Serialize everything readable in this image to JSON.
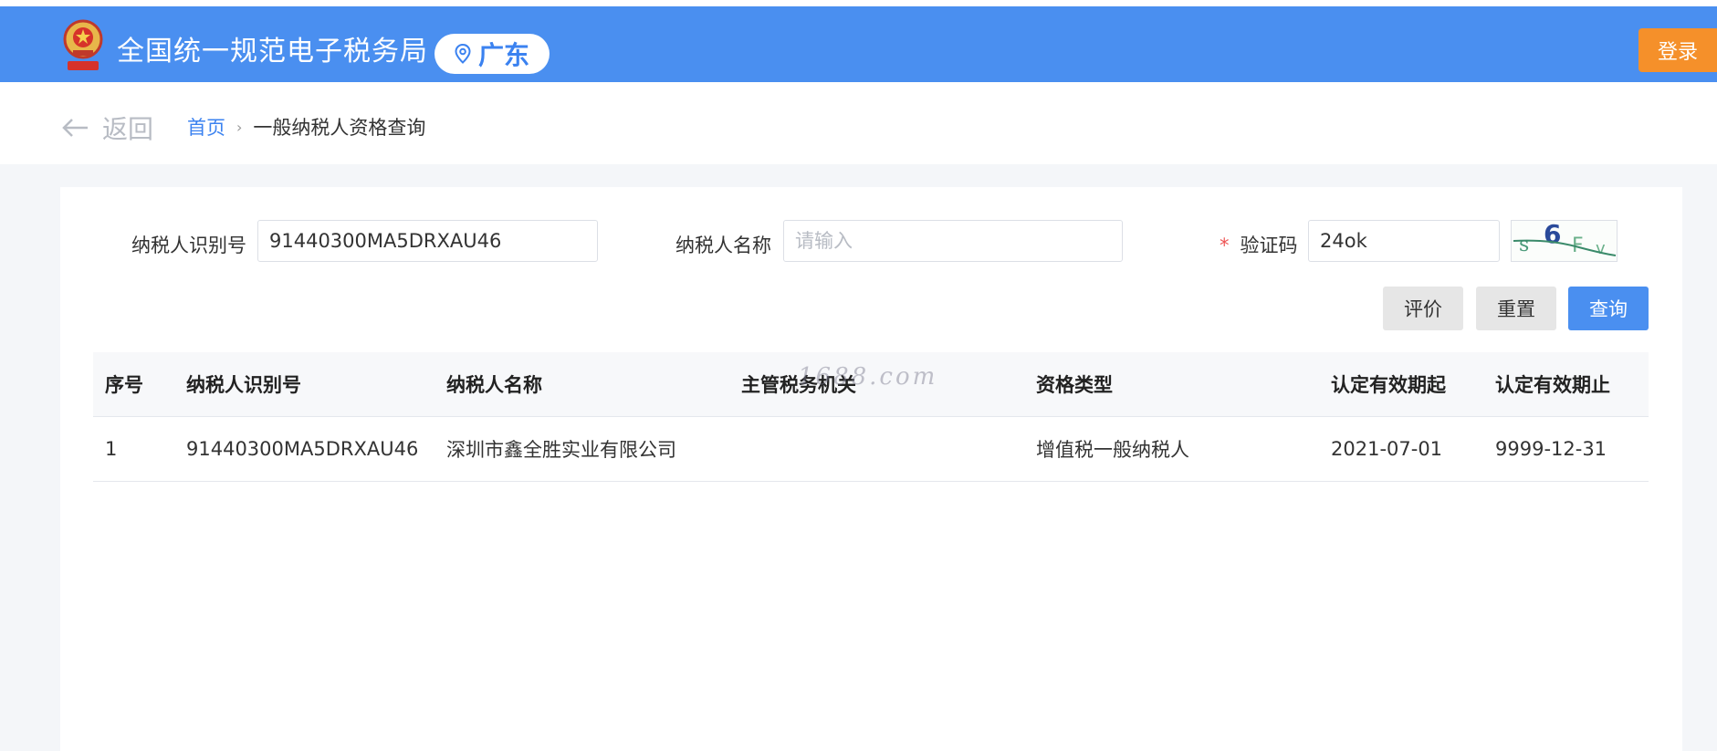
{
  "header": {
    "site_title": "全国统一规范电子税务局",
    "region": "广东",
    "login_label": "登录",
    "bg_color": "#4a8ff0",
    "login_color": "#f5902a"
  },
  "breadcrumb": {
    "back_label": "返回",
    "home": "首页",
    "current": "一般纳税人资格查询"
  },
  "form": {
    "taxpayer_id_label": "纳税人识别号",
    "taxpayer_id_value": "91440300MA5DRXAU46",
    "taxpayer_name_label": "纳税人名称",
    "taxpayer_name_placeholder": "请输入",
    "captcha_required_mark": "*",
    "captcha_label": "验证码",
    "captcha_value": "24ok",
    "captcha_image_text": "s6Fv"
  },
  "buttons": {
    "evaluate": "评价",
    "reset": "重置",
    "query": "查询"
  },
  "table": {
    "headers": [
      "序号",
      "纳税人识别号",
      "纳税人名称",
      "主管税务机关",
      "资格类型",
      "认定有效期起",
      "认定有效期止"
    ],
    "rows": [
      [
        "1",
        "91440300MA5DRXAU46",
        "深圳市鑫全胜实业有限公司",
        "",
        "增值税一般纳税人",
        "2021-07-01",
        "9999-12-31"
      ]
    ]
  },
  "watermark": "1688.com"
}
